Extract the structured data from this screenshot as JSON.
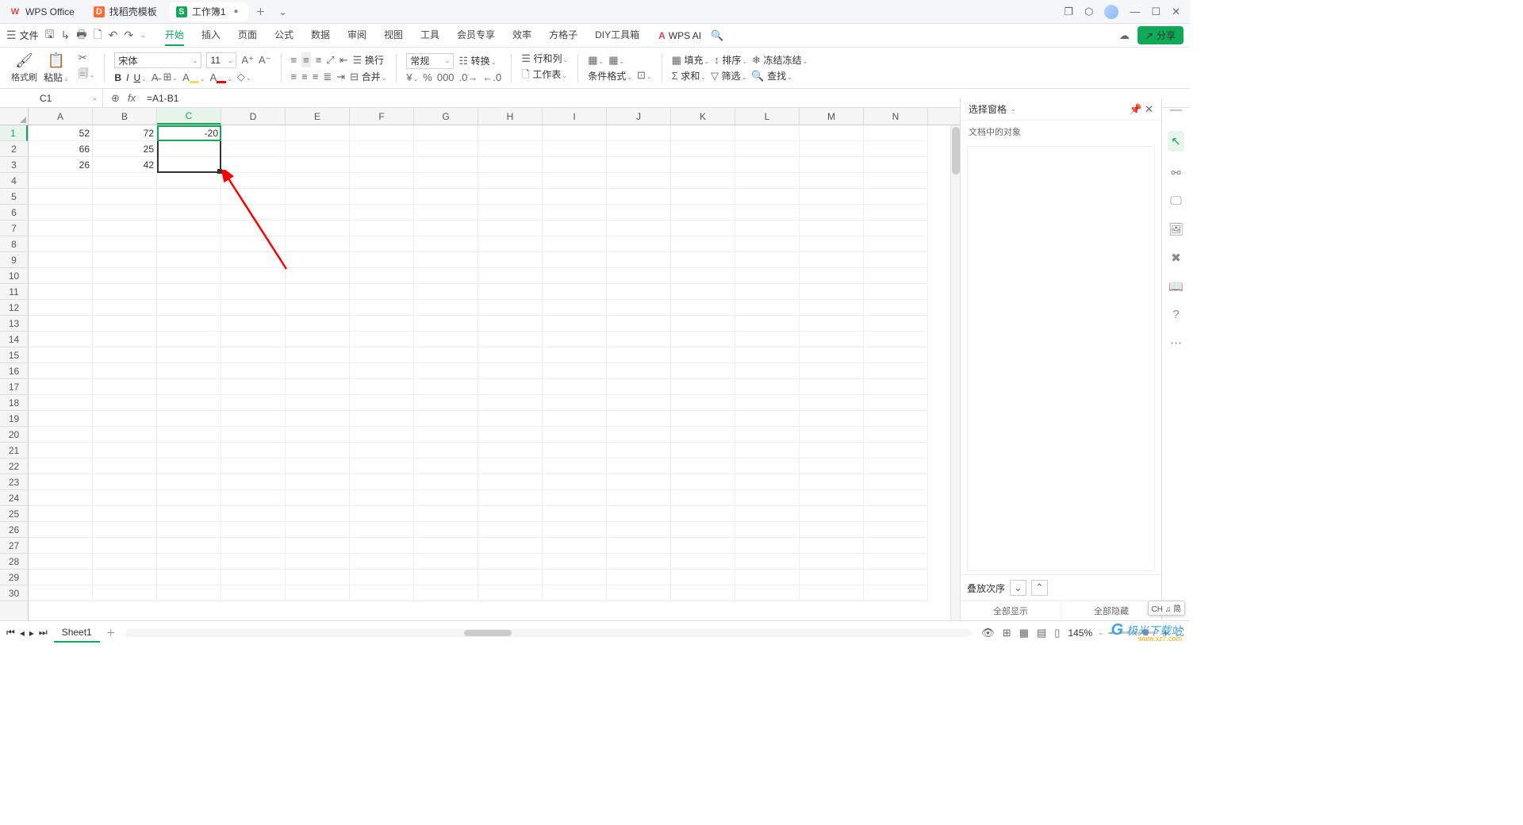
{
  "tabs": {
    "wps": "WPS Office",
    "tpl": "找稻壳模板",
    "doc": "工作簿1"
  },
  "menu": {
    "file": "文件",
    "items": [
      "开始",
      "插入",
      "页面",
      "公式",
      "数据",
      "审阅",
      "视图",
      "工具",
      "会员专享",
      "效率",
      "方格子",
      "DIY工具箱"
    ],
    "ai": "WPS AI",
    "share": "分享"
  },
  "ribbon": {
    "format_painter": "格式刷",
    "paste": "粘贴",
    "font_name": "宋体",
    "font_size": "11",
    "wrap": "换行",
    "merge": "合并",
    "general": "常规",
    "convert": "转换",
    "rowcol": "行和列",
    "worksheet": "工作表",
    "cond": "条件格式",
    "fill": "填充",
    "sort": "排序",
    "freeze": "冻结",
    "sum": "求和",
    "filter": "筛选",
    "find": "查找"
  },
  "namebox": "C1",
  "formula": "=A1-B1",
  "columns": [
    "A",
    "B",
    "C",
    "D",
    "E",
    "F",
    "G",
    "H",
    "I",
    "J",
    "K",
    "L",
    "M",
    "N"
  ],
  "rows": [
    "1",
    "2",
    "3",
    "4",
    "5",
    "6",
    "7",
    "8",
    "9",
    "10",
    "11",
    "12",
    "13",
    "14",
    "15",
    "16",
    "17",
    "18",
    "19",
    "20",
    "21",
    "22",
    "23",
    "24",
    "25",
    "26",
    "27",
    "28",
    "29",
    "30"
  ],
  "cells": {
    "A1": "52",
    "B1": "72",
    "C1": "-20",
    "A2": "66",
    "B2": "25",
    "A3": "26",
    "B3": "42"
  },
  "panel": {
    "title": "选择窗格",
    "subtitle": "文档中的对象",
    "stack": "叠放次序",
    "showall": "全部显示",
    "hideall": "全部隐藏"
  },
  "sheet_tab": "Sheet1",
  "zoom": "145%",
  "ime": "CH ♫ 简",
  "watermark": {
    "brand": "极光下载站",
    "url": "www.xz7.com"
  }
}
